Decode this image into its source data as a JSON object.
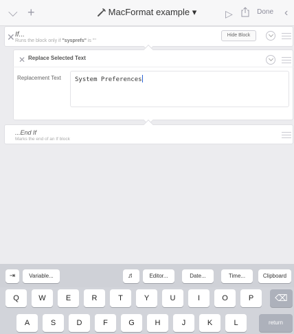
{
  "toolbar": {
    "title": "MacFormat example",
    "title_caret": "▾",
    "done_label": "Done",
    "chevron_down": "⌵",
    "plus": "+",
    "play": "▷",
    "back": "‹"
  },
  "if_block": {
    "title": "If...",
    "subtitle_pre": "Runs the block only if ",
    "subtitle_var": "\"sysprefs\"",
    "subtitle_post": " is \"\"",
    "hide_block_label": "Hide Block",
    "close": "✕"
  },
  "replace_block": {
    "title": "Replace Selected Text",
    "field_label": "Replacement Text",
    "field_value": "System Preferences",
    "close": "✕"
  },
  "endif_block": {
    "title": "...End If",
    "subtitle": "Marks the end of an If block"
  },
  "keyboard": {
    "accessory": {
      "tab": "⇥",
      "variable": "Variable...",
      "magic": "♬",
      "editor": "Editor...",
      "date": "Date...",
      "time": "Time...",
      "clipboard": "Clipboard"
    },
    "row1": [
      "Q",
      "W",
      "E",
      "R",
      "T",
      "Y",
      "U",
      "I",
      "O",
      "P"
    ],
    "delete": "⌫",
    "row2": [
      "A",
      "S",
      "D",
      "F",
      "G",
      "H",
      "J",
      "K",
      "L"
    ],
    "return_label": "return"
  }
}
